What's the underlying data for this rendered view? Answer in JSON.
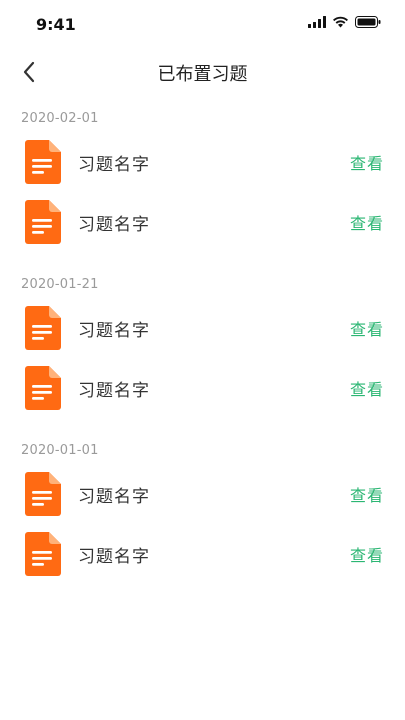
{
  "status_bar": {
    "time": "9:41"
  },
  "nav": {
    "title": "已布置习题"
  },
  "groups": [
    {
      "date": "2020-02-01",
      "items": [
        {
          "name": "习题名字",
          "action": "查看"
        },
        {
          "name": "习题名字",
          "action": "查看"
        }
      ]
    },
    {
      "date": "2020-01-21",
      "items": [
        {
          "name": "习题名字",
          "action": "查看"
        },
        {
          "name": "习题名字",
          "action": "查看"
        }
      ]
    },
    {
      "date": "2020-01-01",
      "items": [
        {
          "name": "习题名字",
          "action": "查看"
        },
        {
          "name": "习题名字",
          "action": "查看"
        }
      ]
    }
  ],
  "colors": {
    "accent": "#2bb673",
    "icon": "#ff6a13",
    "date_text": "#9a9a9a"
  },
  "icons": {
    "item": "document-icon",
    "back": "chevron-left-icon"
  }
}
